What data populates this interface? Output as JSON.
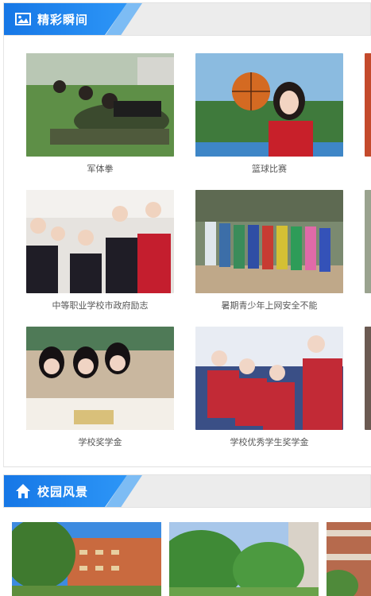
{
  "moments": {
    "title": "精彩瞬间",
    "icon": "image-icon",
    "items": [
      {
        "caption": "军体拳"
      },
      {
        "caption": "篮球比赛"
      },
      {
        "caption": "中等职业学校市政府励志"
      },
      {
        "caption": "暑期青少年上网安全不能"
      },
      {
        "caption": "学校奖学金"
      },
      {
        "caption": "学校优秀学生奖学金"
      }
    ]
  },
  "campus": {
    "title": "校园风景",
    "icon": "home-icon"
  },
  "colors": {
    "header_blue": "#1677e6",
    "header_stripe": "#7dbcf4",
    "header_bg": "#ececec",
    "caption_text": "#555555"
  }
}
